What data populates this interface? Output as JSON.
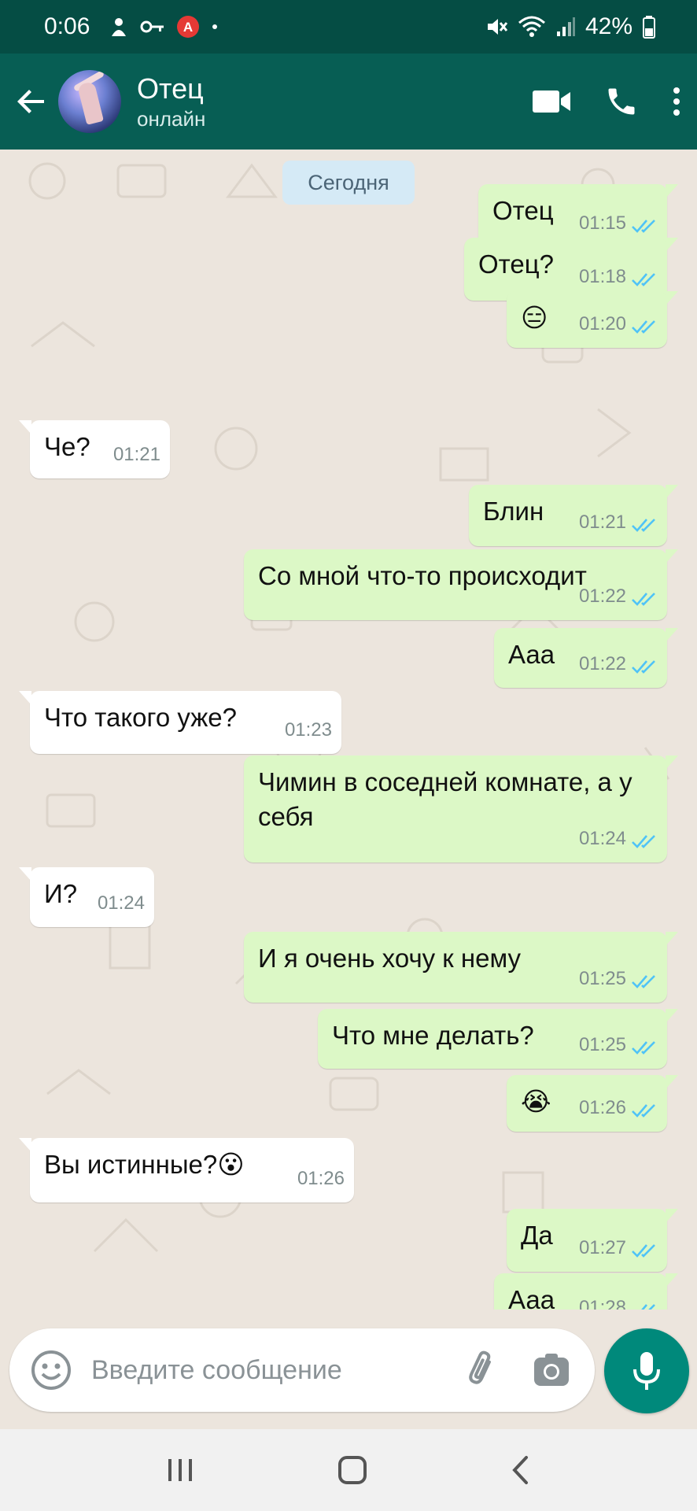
{
  "status_bar": {
    "time": "0:06",
    "battery": "42%"
  },
  "header": {
    "contact_name": "Отец",
    "contact_status": "онлайн"
  },
  "date_separator": "Сегодня",
  "messages": [
    {
      "dir": "out",
      "text": "Отец",
      "time": "01:15"
    },
    {
      "dir": "out",
      "text": "Отец?",
      "time": "01:18"
    },
    {
      "dir": "out",
      "text": "😑",
      "time": "01:20"
    },
    {
      "dir": "in",
      "text": "Че?",
      "time": "01:21"
    },
    {
      "dir": "out",
      "text": "Блин",
      "time": "01:21"
    },
    {
      "dir": "out",
      "text": "Со мной что-то происходит",
      "time": "01:22"
    },
    {
      "dir": "out",
      "text": "Ааа",
      "time": "01:22"
    },
    {
      "dir": "in",
      "text": "Что такого уже?",
      "time": "01:23"
    },
    {
      "dir": "out",
      "text": "Чимин в соседней комнате, а у себя",
      "time": "01:24"
    },
    {
      "dir": "in",
      "text": "И?",
      "time": "01:24"
    },
    {
      "dir": "out",
      "text": "И я очень хочу к нему",
      "time": "01:25"
    },
    {
      "dir": "out",
      "text": "Что мне делать?",
      "time": "01:25"
    },
    {
      "dir": "out",
      "text": "😭",
      "time": "01:26"
    },
    {
      "dir": "in",
      "text": "Вы истинные?😮",
      "time": "01:26"
    },
    {
      "dir": "out",
      "text": "Да",
      "time": "01:27"
    },
    {
      "dir": "out",
      "text": "Ааа",
      "time": "01:28"
    }
  ],
  "composer": {
    "placeholder": "Введите сообщение"
  },
  "icons": {
    "back": "arrow-left-icon",
    "video": "video-call-icon",
    "call": "phone-icon",
    "menu": "more-vert-icon",
    "emoji": "emoji-icon",
    "attach": "paperclip-icon",
    "camera": "camera-icon",
    "mic": "mic-icon",
    "ticks": "double-check-icon"
  },
  "colors": {
    "header": "#075e54",
    "status_bar": "#054d44",
    "outgoing_bubble": "#dcf8c6",
    "incoming_bubble": "#ffffff",
    "read_ticks": "#4fc3f7",
    "mic_button": "#00897b"
  }
}
